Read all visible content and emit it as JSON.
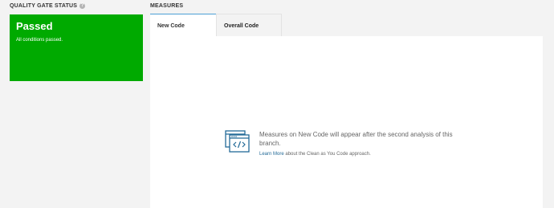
{
  "quality_gate": {
    "header": "QUALITY GATE STATUS",
    "help_icon": "help-circle-icon",
    "status": "Passed",
    "subtitle": "All conditions passed.",
    "color": "#00aa00"
  },
  "measures": {
    "header": "MEASURES",
    "tabs": [
      {
        "label": "New Code",
        "active": true
      },
      {
        "label": "Overall Code",
        "active": false
      }
    ],
    "empty_state": {
      "icon": "code-window-icon",
      "message": "Measures on New Code will appear after the second analysis of this branch.",
      "link_text": "Learn More",
      "link_suffix": " about the Clean as You Code approach."
    }
  },
  "colors": {
    "accent": "#4b9fd5",
    "link": "#236a97",
    "background": "#f3f3f3"
  }
}
